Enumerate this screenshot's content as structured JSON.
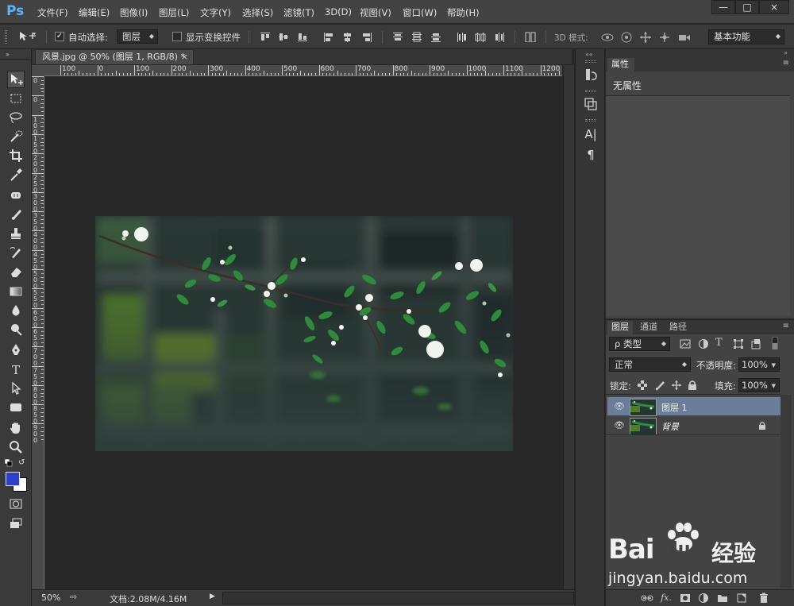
{
  "app": {
    "logo": "Ps",
    "menu": [
      "文件(F)",
      "编辑(E)",
      "图像(I)",
      "图层(L)",
      "文字(Y)",
      "选择(S)",
      "滤镜(T)",
      "3D(D)",
      "视图(V)",
      "窗口(W)",
      "帮助(H)"
    ],
    "window_buttons": [
      "—",
      "□",
      "×"
    ]
  },
  "options": {
    "auto_select_label": "自动选择:",
    "auto_select_value": "图层",
    "show_transform_label": "显示变换控件",
    "mode_3d_label": "3D 模式:",
    "workspace": "基本功能"
  },
  "document": {
    "tab_title": "风景.jpg @ 50% (图层 1, RGB/8) *",
    "close": "×",
    "zoom": "50%",
    "doc_size": "文档:2.08M/4.16M"
  },
  "ruler": {
    "h_labels": [
      "100",
      "0",
      "100",
      "200",
      "300",
      "400",
      "500",
      "600",
      "700",
      "800",
      "900",
      "1000",
      "1100",
      "1200"
    ],
    "v_labels": [
      "0",
      "0",
      "1 0 0",
      "1 5 0",
      "2 0 0",
      "2 5 0",
      "3 0 0",
      "3 5 0",
      "4 0 0",
      "4 5 0",
      "5 0 0",
      "5 5 0",
      "6 0 0",
      "6 5 0",
      "7 0 0",
      "7 5 0",
      "8 0 0",
      "8 5 0",
      "9 0 0"
    ]
  },
  "properties": {
    "tab": "属性",
    "empty_text": "无属性"
  },
  "layers": {
    "tabs": [
      "图层",
      "通道",
      "路径"
    ],
    "filter_label": "ρ 类型",
    "blend_mode": "正常",
    "opacity_label": "不透明度:",
    "opacity_value": "100%",
    "lock_label": "锁定:",
    "fill_label": "填充:",
    "fill_value": "100%",
    "items": [
      {
        "name": "图层 1",
        "selected": true
      },
      {
        "name": "背景",
        "locked": true
      }
    ],
    "bottom_icons": [
      "link-icon",
      "fx-icon",
      "mask-icon",
      "adjustment-icon",
      "group-icon",
      "new-layer-icon",
      "trash-icon"
    ]
  },
  "watermark": {
    "brand": "Bai",
    "brand_suffix": "du",
    "cn": "经验",
    "url": "jingyan.baidu.com"
  },
  "colors": {
    "foreground": "#2b3fc8",
    "background": "#ffffff",
    "selected_layer": "#6a7d99",
    "ps_blue": "#5bb4f4"
  }
}
